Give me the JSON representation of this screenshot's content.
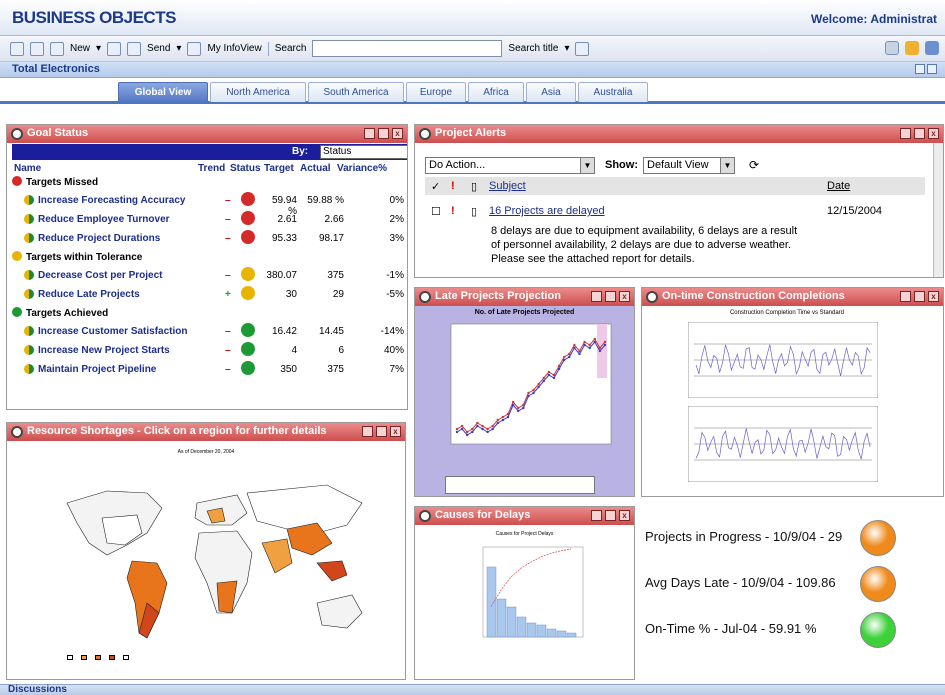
{
  "app": {
    "brand": "BUSINESS OBJECTS",
    "welcome": "Welcome: Administrat"
  },
  "toolbar": {
    "new_label": "New",
    "send_label": "Send",
    "myinfoview_label": "My InfoView",
    "search_label": "Search",
    "search_value": "",
    "search_title_label": "Search title"
  },
  "subbar": {
    "title": "Total Electronics"
  },
  "tabs": [
    {
      "label": "Global View",
      "active": true
    },
    {
      "label": "North America"
    },
    {
      "label": "South America"
    },
    {
      "label": "Europe"
    },
    {
      "label": "Africa"
    },
    {
      "label": "Asia"
    },
    {
      "label": "Australia"
    }
  ],
  "goal_status": {
    "title": "Goal Status",
    "by_label": "By:",
    "by_value": "Status",
    "columns": {
      "name": "Name",
      "trend": "Trend",
      "status": "Status",
      "target": "Target",
      "actual": "Actual",
      "variance": "Variance%"
    },
    "sections": [
      {
        "title": "Targets Missed",
        "color": "#d42a2a",
        "rows": [
          {
            "name": "Increase Forecasting Accuracy",
            "trend": "–",
            "target": "59.94 %",
            "actual": "59.88 %",
            "variance": "0%"
          },
          {
            "name": "Reduce Employee Turnover",
            "trend": "–",
            "target": "2.61",
            "actual": "2.66",
            "variance": "2%"
          },
          {
            "name": "Reduce Project Durations",
            "trend": "–",
            "target": "95.33",
            "actual": "98.17",
            "variance": "3%"
          }
        ]
      },
      {
        "title": "Targets within Tolerance",
        "color": "#e8b400",
        "rows": [
          {
            "name": "Decrease Cost per Project",
            "trend": "–",
            "target": "380.07",
            "actual": "375",
            "variance": "-1%"
          },
          {
            "name": "Reduce Late Projects",
            "trend": "+",
            "target": "30",
            "actual": "29",
            "variance": "-5%"
          }
        ]
      },
      {
        "title": "Targets Achieved",
        "color": "#1d9a36",
        "rows": [
          {
            "name": "Increase Customer Satisfaction",
            "trend": "–",
            "target": "16.42",
            "actual": "14.45",
            "variance": "-14%"
          },
          {
            "name": "Increase New Project Starts",
            "trend": "–",
            "target": "4",
            "actual": "6",
            "variance": "40%"
          },
          {
            "name": "Maintain Project Pipeline",
            "trend": "–",
            "target": "350",
            "actual": "375",
            "variance": "7%"
          }
        ]
      }
    ]
  },
  "project_alerts": {
    "title": "Project Alerts",
    "action_value": "Do Action...",
    "show_label": "Show:",
    "show_value": "Default View",
    "col_subject": "Subject",
    "col_date": "Date",
    "alert_subject": "16 Projects are delayed",
    "alert_date": "12/15/2004",
    "alert_body_1": "8 delays are due to equipment availability, 6 delays are a result",
    "alert_body_2": "of personnel availability, 2 delays are due to adverse weather.",
    "alert_body_3": "Please see the attached report for details."
  },
  "late_projects": {
    "title": "Late Projects Projection",
    "chart_title": "No. of Late Projects Projected"
  },
  "ontime": {
    "title": "On-time Construction Completions",
    "chart_title": "Construction Completion Time vs Standard"
  },
  "resource": {
    "title": "Resource Shortages - Click on a region for further details",
    "subtitle": "As of December 20, 2004"
  },
  "causes": {
    "title": "Causes for Delays",
    "chart_title": "Causes for Project Delays"
  },
  "kpis": [
    {
      "label": "Projects in Progress - 10/9/04 - 29",
      "color": "#f08a1c"
    },
    {
      "label": "Avg Days Late - 10/9/04 - 109.86",
      "color": "#f08a1c"
    },
    {
      "label": "On-Time % - Jul-04 - 59.91 %",
      "color": "#3fd13a"
    }
  ],
  "footer": {
    "label": "Discussions"
  },
  "chart_data": [
    {
      "type": "line",
      "title": "No. of Late Projects Projected",
      "series": [
        {
          "name": "",
          "values": [
            5,
            6,
            4,
            5,
            7,
            6,
            5,
            6,
            8,
            9,
            10,
            14,
            12,
            13,
            17,
            18,
            20,
            22,
            24,
            23,
            26,
            29,
            30,
            33,
            31,
            34,
            33,
            35,
            32,
            34
          ]
        }
      ]
    }
  ]
}
